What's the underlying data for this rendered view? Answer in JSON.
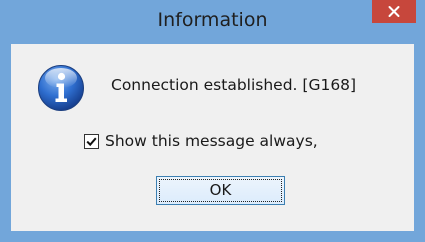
{
  "window": {
    "title": "Information",
    "frame_color": "#72a6da",
    "close_button_color": "#c7473c",
    "close_icon": "close-icon"
  },
  "dialog": {
    "icon": "info-icon",
    "message": "Connection established. [G168]",
    "checkbox": {
      "label": "Show this message always,",
      "checked": true
    },
    "ok_label": "OK"
  }
}
